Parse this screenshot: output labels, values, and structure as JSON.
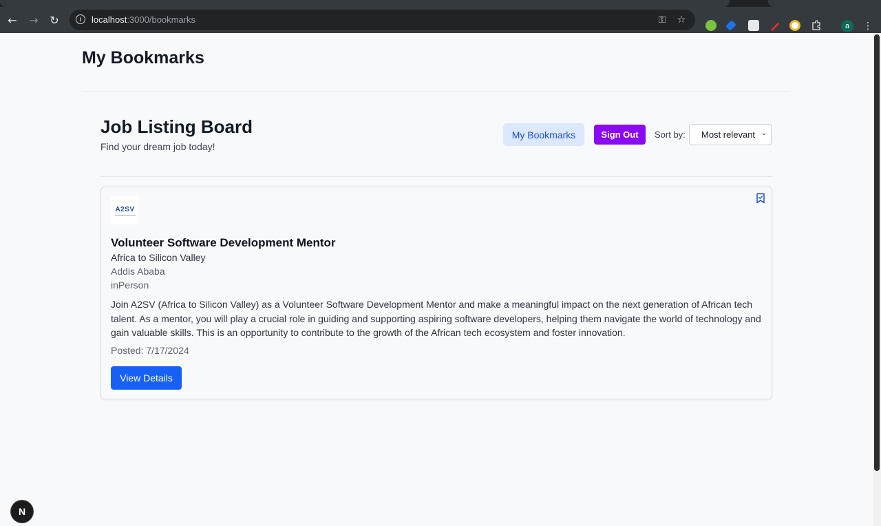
{
  "browser": {
    "url_host": "localhost",
    "url_path": ":3000/bookmarks",
    "profile_initial": "a"
  },
  "page": {
    "title": "My Bookmarks"
  },
  "board": {
    "title": "Job Listing Board",
    "subtitle": "Find your dream job today!",
    "bookmarks_button": "My Bookmarks",
    "signout_button": "Sign Out",
    "sort_label": "Sort by:",
    "sort_value": "Most relevant"
  },
  "job": {
    "logo_text": "A2SV",
    "title": "Volunteer Software Development Mentor",
    "company": "Africa to Silicon Valley",
    "location": "Addis Ababa",
    "type": "inPerson",
    "description": "Join A2SV (Africa to Silicon Valley) as a Volunteer Software Development Mentor and make a meaningful impact on the next generation of African tech talent. As a mentor, you will play a crucial role in guiding and supporting aspiring software developers, helping them navigate the world of technology and gain valuable skills. This is an opportunity to contribute to the growth of the African tech ecosystem and foster innovation.",
    "posted": "Posted: 7/17/2024",
    "details_button": "View Details",
    "bookmarked": true
  },
  "dev_badge": "N",
  "colors": {
    "signout": "#8b08f5",
    "primary": "#1660f5",
    "bookmarks_bg": "#dbe8fd"
  }
}
